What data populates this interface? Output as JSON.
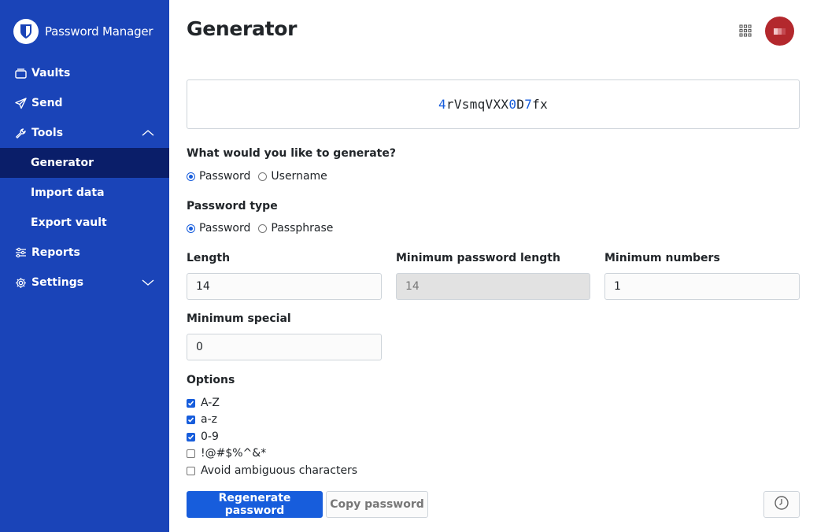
{
  "app": {
    "brand": "Password Manager"
  },
  "sidebar": {
    "items": [
      {
        "label": "Vaults",
        "icon": "vault-icon"
      },
      {
        "label": "Send",
        "icon": "send-icon"
      },
      {
        "label": "Tools",
        "icon": "wrench-icon",
        "expanded": true
      },
      {
        "label": "Generator",
        "active": true
      },
      {
        "label": "Import data"
      },
      {
        "label": "Export vault"
      },
      {
        "label": "Reports",
        "icon": "sliders-icon"
      },
      {
        "label": "Settings",
        "icon": "gear-icon",
        "expanded": false
      }
    ]
  },
  "header": {
    "title": "Generator"
  },
  "generated": {
    "segments": [
      {
        "text": "4",
        "type": "number"
      },
      {
        "text": "rVsmqVXX",
        "type": "letter"
      },
      {
        "text": "0",
        "type": "number"
      },
      {
        "text": "D",
        "type": "letter"
      },
      {
        "text": "7",
        "type": "number"
      },
      {
        "text": "fx",
        "type": "letter"
      }
    ]
  },
  "generate_type": {
    "label": "What would you like to generate?",
    "options": [
      "Password",
      "Username"
    ],
    "selected": "Password"
  },
  "password_type": {
    "label": "Password type",
    "options": [
      "Password",
      "Passphrase"
    ],
    "selected": "Password"
  },
  "fields": {
    "length": {
      "label": "Length",
      "value": "14"
    },
    "min_length": {
      "label": "Minimum password length",
      "value": "14"
    },
    "min_numbers": {
      "label": "Minimum numbers",
      "value": "1"
    },
    "min_special": {
      "label": "Minimum special",
      "value": "0"
    }
  },
  "options": {
    "label": "Options",
    "items": [
      {
        "label": "A-Z",
        "checked": true
      },
      {
        "label": "a-z",
        "checked": true
      },
      {
        "label": "0-9",
        "checked": true
      },
      {
        "label": "!@#$%^&*",
        "checked": false
      },
      {
        "label": "Avoid ambiguous characters",
        "checked": false
      }
    ]
  },
  "buttons": {
    "regenerate": "Regenerate password",
    "copy": "Copy password"
  },
  "colors": {
    "sidebar": "#1a44b8",
    "accent": "#175ddc",
    "active_nav": "#0a1e69",
    "avatar": "#b3282d"
  }
}
